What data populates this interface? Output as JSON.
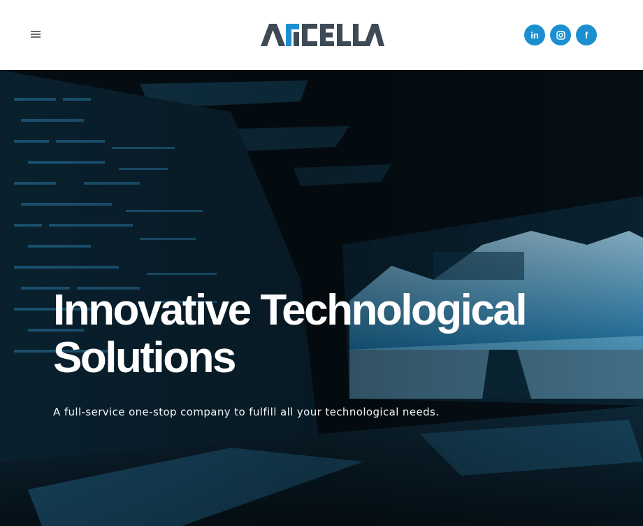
{
  "header": {
    "menu_icon": "hamburger-icon",
    "logo_text": "ARCELLA",
    "socials": [
      {
        "icon": "linkedin-icon",
        "glyph": "in"
      },
      {
        "icon": "instagram-icon",
        "glyph": ""
      },
      {
        "icon": "facebook-icon",
        "glyph": "f"
      }
    ],
    "accent_color": "#1b8fcf"
  },
  "hero": {
    "title_line1": "Innovative Technological",
    "title_line2": "Solutions",
    "subtitle": "A full-service one-stop company to fulfill all your technological needs.",
    "overlay_color": "#0e88c4"
  }
}
